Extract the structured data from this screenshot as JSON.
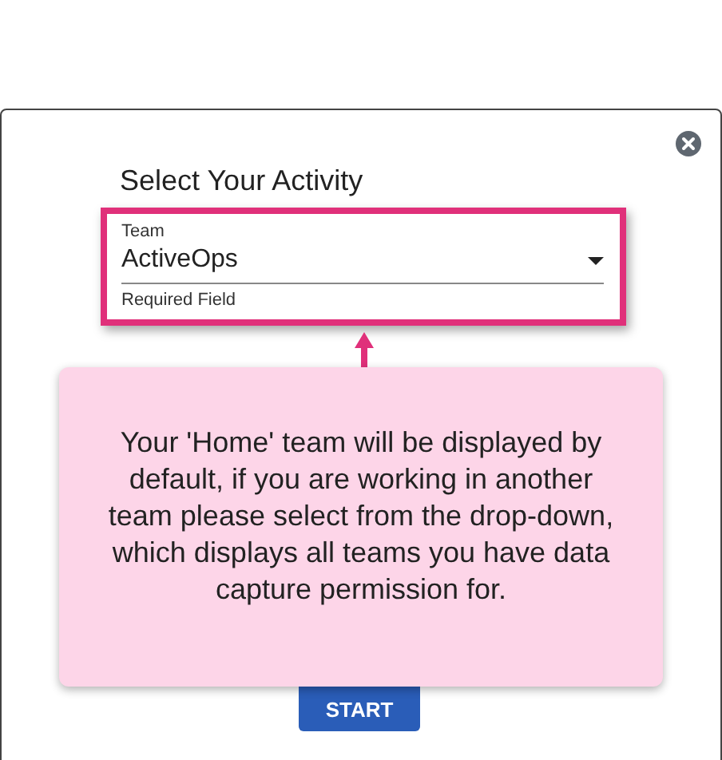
{
  "dialog": {
    "title": "Select Your Activity",
    "field": {
      "label": "Team",
      "value": "ActiveOps",
      "helper": "Required Field"
    },
    "tooltip": {
      "text": "Your 'Home' team will be displayed by default, if you are working in another team please select from the drop-down, which displays all teams you have data capture permission for."
    },
    "buttons": [
      "START"
    ]
  }
}
